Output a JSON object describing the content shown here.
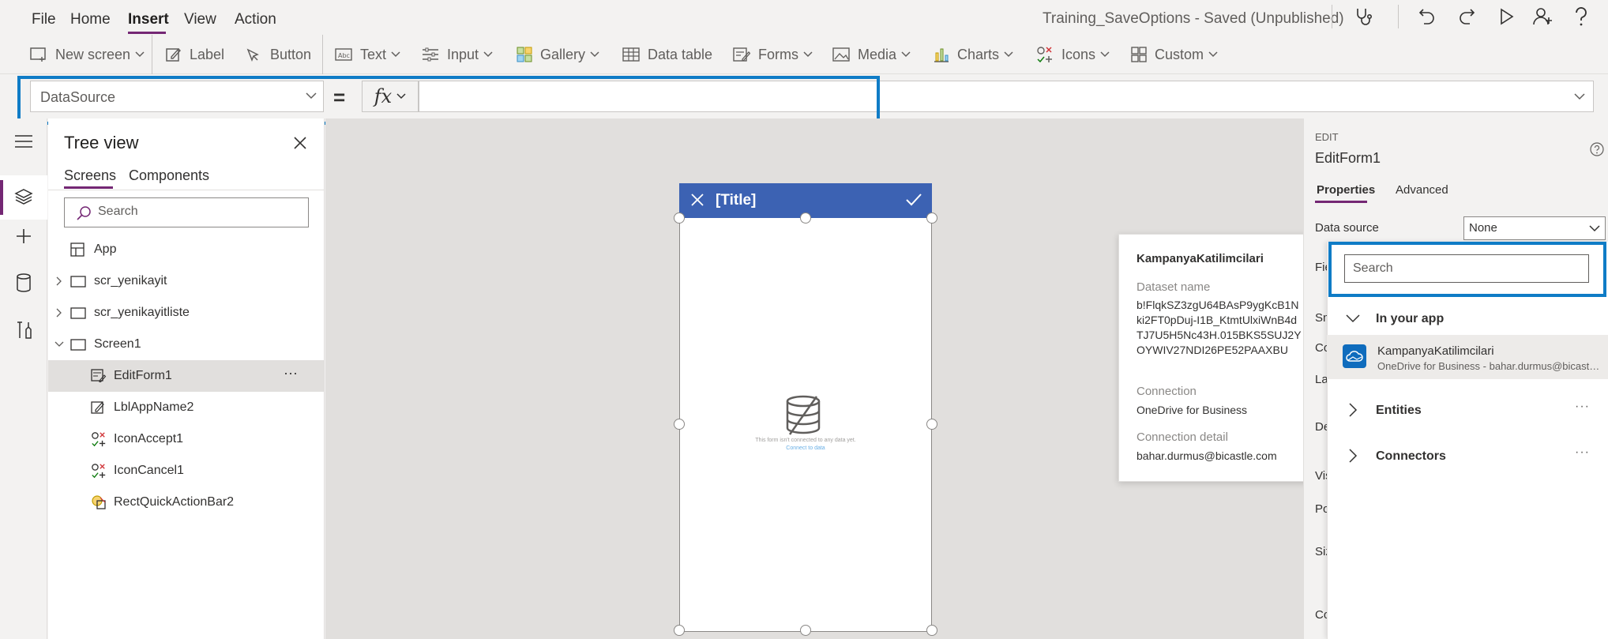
{
  "menu": {
    "items": [
      "File",
      "Home",
      "Insert",
      "View",
      "Action"
    ],
    "active": "Insert",
    "app_status": "Training_SaveOptions - Saved (Unpublished)"
  },
  "ribbon": {
    "new_screen": "New screen",
    "label": "Label",
    "button": "Button",
    "text": "Text",
    "input": "Input",
    "gallery": "Gallery",
    "data_table": "Data table",
    "forms": "Forms",
    "media": "Media",
    "charts": "Charts",
    "icons": "Icons",
    "custom": "Custom"
  },
  "formula": {
    "property": "DataSource",
    "equals": "=",
    "fx": "fx",
    "value": ""
  },
  "tree": {
    "title": "Tree view",
    "tabs": [
      "Screens",
      "Components"
    ],
    "search_placeholder": "Search",
    "items": [
      {
        "label": "App"
      },
      {
        "label": "scr_yenikayit"
      },
      {
        "label": "scr_yenikayitliste"
      },
      {
        "label": "Screen1"
      },
      {
        "label": "EditForm1"
      },
      {
        "label": "LblAppName2"
      },
      {
        "label": "IconAccept1"
      },
      {
        "label": "IconCancel1"
      },
      {
        "label": "RectQuickActionBar2"
      }
    ],
    "more": "···"
  },
  "phone": {
    "title": "[Title]",
    "empty_message": "This form isn't connected to any data yet.",
    "connect_link": "Connect to data"
  },
  "tooltip": {
    "title": "KampanyaKatilimcilari",
    "dataset_label": "Dataset name",
    "dataset_value": "b!FlqkSZ3zgU64BAsP9ygKcB1Nki2FT0pDuj-I1B_KtmtUlxiWnB4dTJ7U5H5Nc43H.015BKS5SUJ2YOYWIV27NDI26PE52PAAXBU",
    "connection_label": "Connection",
    "connection_value": "OneDrive for Business",
    "detail_label": "Connection detail",
    "detail_value": "bahar.durmus@bicastle.com"
  },
  "props": {
    "edit_label": "EDIT",
    "control_name": "EditForm1",
    "tabs": [
      "Properties",
      "Advanced"
    ],
    "data_source_label": "Data source",
    "data_source_value": "None",
    "peek_labels": [
      "Fie",
      "Sn",
      "Co",
      "La",
      "De",
      "Vis",
      "Po",
      "Siz",
      "Co"
    ]
  },
  "flyout": {
    "search_placeholder": "Search",
    "in_your_app": "In your app",
    "item_name": "KampanyaKatilimcilari",
    "item_sub": "OneDrive for Business - bahar.durmus@bicastle.com",
    "entities": "Entities",
    "connectors": "Connectors",
    "more": "···"
  },
  "colors": {
    "accent_purple": "#742774",
    "highlight_blue": "#0f7cc6",
    "form_header_blue": "#3c62b3"
  }
}
